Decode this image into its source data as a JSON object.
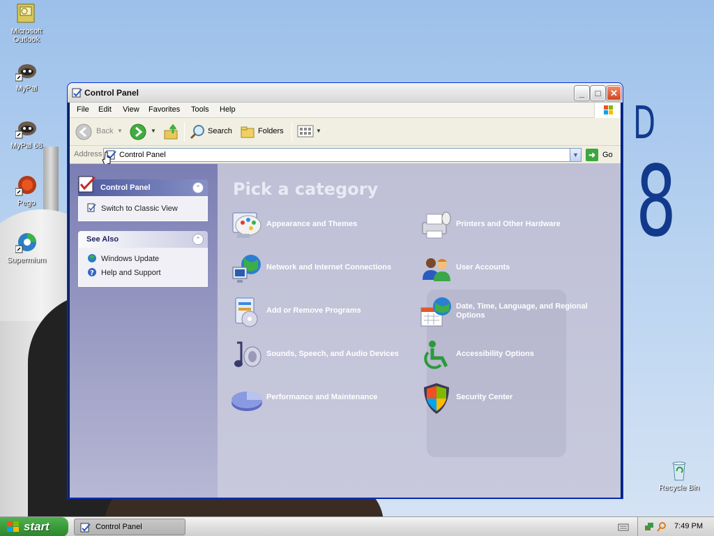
{
  "desktop": {
    "icons": [
      {
        "label": "Microsoft Outlook",
        "icon": "outlook-icon"
      },
      {
        "label": "MyPal",
        "icon": "mypal-icon"
      },
      {
        "label": "MyPal 68",
        "icon": "mypal-icon"
      },
      {
        "label": "Pego",
        "icon": "pego-icon"
      },
      {
        "label": "Supermium",
        "icon": "supermium-icon"
      },
      {
        "label": "Recycle Bin",
        "icon": "recycle-bin-icon"
      }
    ],
    "wallpaper_text": {
      "letter": "D",
      "number": "8"
    }
  },
  "window": {
    "title": "Control Panel",
    "menu": [
      "File",
      "Edit",
      "View",
      "Favorites",
      "Tools",
      "Help"
    ],
    "toolbar": {
      "back": "Back",
      "search": "Search",
      "folders": "Folders"
    },
    "address": {
      "label": "Address",
      "value": "Control Panel",
      "go": "Go"
    }
  },
  "taskpane": {
    "control_panel": {
      "title": "Control Panel",
      "link": "Switch to Classic View"
    },
    "see_also": {
      "title": "See Also",
      "links": [
        "Windows Update",
        "Help and Support"
      ]
    }
  },
  "main": {
    "heading": "Pick a category",
    "categories": [
      {
        "label": "Appearance and Themes",
        "icon": "appearance-icon"
      },
      {
        "label": "Printers and Other Hardware",
        "icon": "printer-icon"
      },
      {
        "label": "Network and Internet Connections",
        "icon": "network-icon"
      },
      {
        "label": "User Accounts",
        "icon": "users-icon"
      },
      {
        "label": "Add or Remove Programs",
        "icon": "add-remove-icon"
      },
      {
        "label": "Date, Time, Language, and Regional Options",
        "icon": "calendar-globe-icon"
      },
      {
        "label": "Sounds, Speech, and Audio Devices",
        "icon": "sound-icon"
      },
      {
        "label": "Accessibility Options",
        "icon": "accessibility-icon"
      },
      {
        "label": "Performance and Maintenance",
        "icon": "performance-icon"
      },
      {
        "label": "Security Center",
        "icon": "shield-icon"
      }
    ]
  },
  "taskbar": {
    "start": "start",
    "task": "Control Panel",
    "clock": "7:49 PM"
  }
}
